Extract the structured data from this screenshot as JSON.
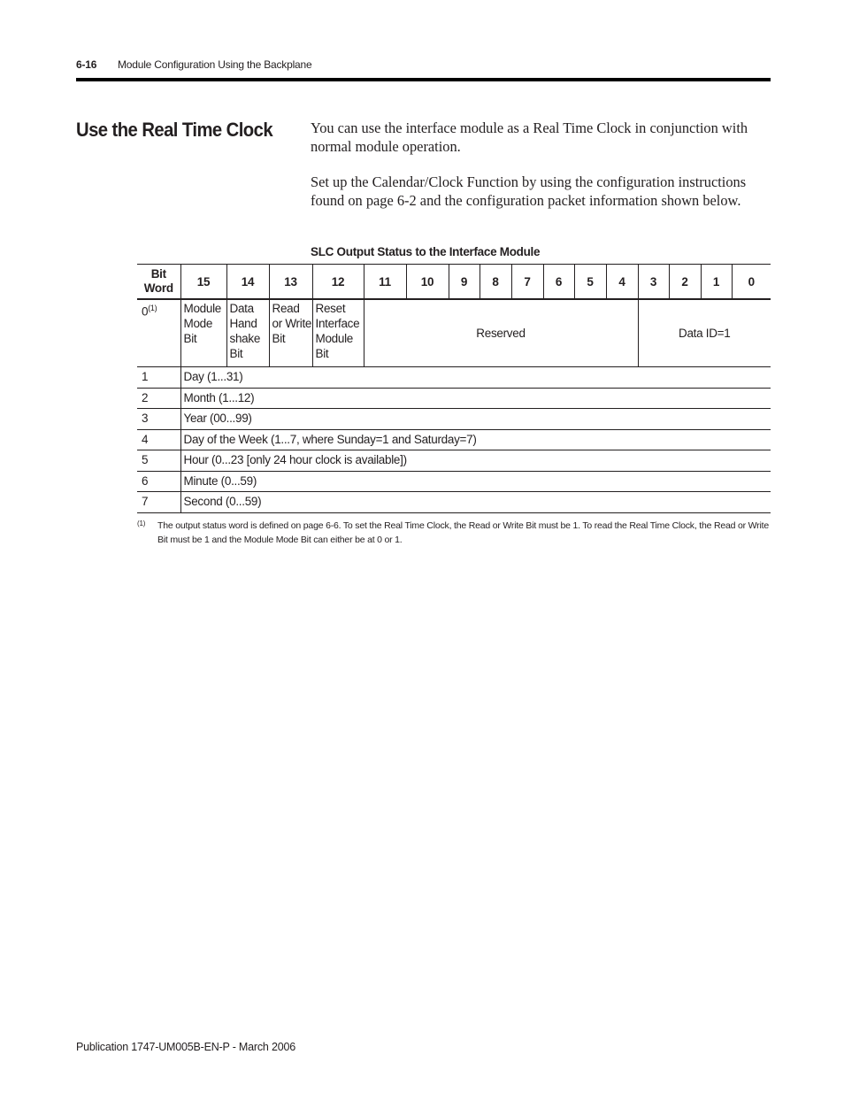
{
  "header": {
    "page_number": "6-16",
    "chapter_title": "Module Configuration Using the Backplane"
  },
  "section": {
    "title": "Use the Real Time Clock",
    "paragraphs": [
      "You can use the interface module as a Real Time Clock in conjunction with normal module operation.",
      "Set up the Calendar/Clock Function by using the configuration instructions found on page 6-2 and the configuration packet information shown below."
    ]
  },
  "table": {
    "caption": "SLC Output Status to the Interface Module",
    "corner_top": "Bit",
    "corner_bottom": "Word",
    "bits": [
      "15",
      "14",
      "13",
      "12",
      "11",
      "10",
      "9",
      "8",
      "7",
      "6",
      "5",
      "4",
      "3",
      "2",
      "1",
      "0"
    ],
    "word0": {
      "word": "0",
      "footnote_ref": "(1)",
      "bit15": "Module Mode Bit",
      "bit14": "Data Hand shake Bit",
      "bit13": "Read or Write Bit",
      "bit12": "Reset Interface Module Bit",
      "bits11_4": "Reserved",
      "bits3_0": "Data ID=1"
    },
    "rows": [
      {
        "word": "1",
        "desc": "Day (1...31)"
      },
      {
        "word": "2",
        "desc": "Month (1...12)"
      },
      {
        "word": "3",
        "desc": "Year (00...99)"
      },
      {
        "word": "4",
        "desc": "Day of the Week (1...7, where Sunday=1 and Saturday=7)"
      },
      {
        "word": "5",
        "desc": "Hour (0...23 [only 24 hour clock is available])"
      },
      {
        "word": "6",
        "desc": "Minute (0...59)"
      },
      {
        "word": "7",
        "desc": "Second (0...59)"
      }
    ]
  },
  "footnote": {
    "marker": "(1)",
    "text": "The output status word is defined on page 6-6. To set the Real Time Clock, the Read or Write Bit must be 1. To read the Real Time Clock, the Read or Write Bit must be 1 and the Module Mode Bit can either be at 0 or 1."
  },
  "footer": {
    "publication": "Publication 1747-UM005B-EN-P - March 2006"
  }
}
